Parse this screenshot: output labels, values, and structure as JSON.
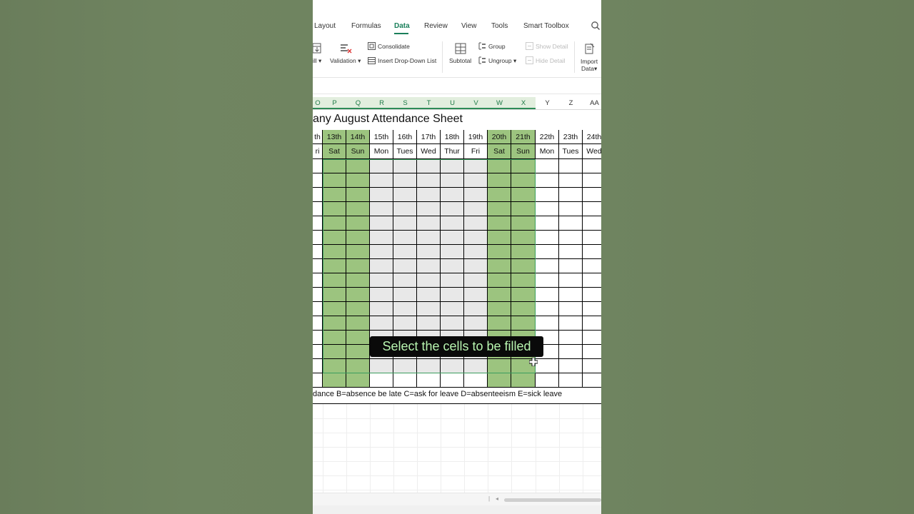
{
  "menu": {
    "tabs": [
      "Layout",
      "Formulas",
      "Data",
      "Review",
      "View",
      "Tools",
      "Smart Toolbox"
    ],
    "active_tab": "Data"
  },
  "ribbon": {
    "fill_label": "ill",
    "validation_label": "Validation",
    "consolidate_label": "Consolidate",
    "dropdown_label": "Insert Drop-Down List",
    "subtotal_label": "Subtotal",
    "group_label": "Group",
    "ungroup_label": "Ungroup",
    "show_detail_label": "Show Detail",
    "hide_detail_label": "Hide Detail",
    "import_label_1": "Import",
    "import_label_2": "Data"
  },
  "column_headers": [
    "O",
    "P",
    "Q",
    "R",
    "S",
    "T",
    "U",
    "V",
    "W",
    "X",
    "Y",
    "Z",
    "AA"
  ],
  "sheet": {
    "title": "any August Attendance Sheet",
    "dates": [
      "th",
      "13th",
      "14th",
      "15th",
      "16th",
      "17th",
      "18th",
      "19th",
      "20th",
      "21th",
      "22th",
      "23th",
      "24th"
    ],
    "days": [
      "ri",
      "Sat",
      "Sun",
      "Mon",
      "Tues",
      "Wed",
      "Thur",
      "Fri",
      "Sat",
      "Sun",
      "Mon",
      "Tues",
      "Wed"
    ],
    "legend": "dance  B=absence be late  C=ask for leave  D=absenteeism  E=sick leave"
  },
  "caption": "Select the cells to be filled",
  "colors": {
    "accent": "#1a7f5a",
    "weekend_fill": "#9cc47f",
    "selection_fill": "#e8e8e8",
    "caption_text": "#b8f5b0"
  }
}
